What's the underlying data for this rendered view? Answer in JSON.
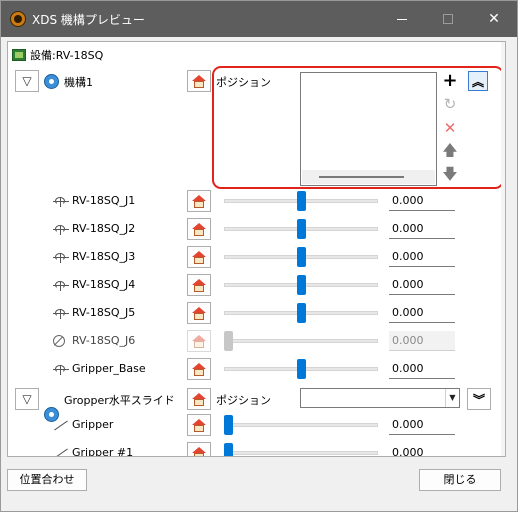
{
  "window": {
    "title": "XDS 機構プレビュー"
  },
  "equipment": {
    "label": "設備:RV-18SQ"
  },
  "mechanism1": {
    "name": "機構1",
    "position_label": "ポジション"
  },
  "joints": [
    {
      "label": "RV-18SQ_J1",
      "value": "0.000",
      "slider_level": 0.5,
      "enabled": true
    },
    {
      "label": "RV-18SQ_J2",
      "value": "0.000",
      "slider_level": 0.5,
      "enabled": true
    },
    {
      "label": "RV-18SQ_J3",
      "value": "0.000",
      "slider_level": 0.5,
      "enabled": true
    },
    {
      "label": "RV-18SQ_J4",
      "value": "0.000",
      "slider_level": 0.5,
      "enabled": true
    },
    {
      "label": "RV-18SQ_J5",
      "value": "0.000",
      "slider_level": 0.5,
      "enabled": true
    },
    {
      "label": "RV-18SQ_J6",
      "value": "0.000",
      "slider_level": 0.0,
      "enabled": false
    },
    {
      "label": "Gripper_Base",
      "value": "0.000",
      "slider_level": 0.5,
      "enabled": true
    }
  ],
  "mechanism2": {
    "name": "Gropper水平スライド",
    "position_label": "ポジション",
    "combo_value": ""
  },
  "grippers": [
    {
      "label": "Gripper",
      "value": "0.000",
      "slider_level": 0.0
    },
    {
      "label": "Gripper #1",
      "value": "0.000",
      "slider_level": 0.0
    }
  ],
  "buttons": {
    "align": "位置合わせ",
    "close": "閉じる"
  },
  "colors": {
    "highlight": "#e2231a",
    "slider_accent": "#0078d7",
    "titlebar": "#5d5d5d"
  }
}
